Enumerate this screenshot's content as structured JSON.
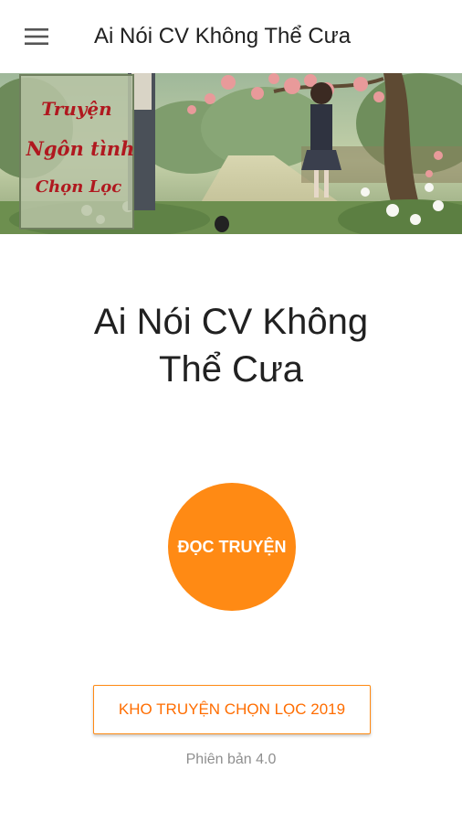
{
  "app_bar": {
    "title": "Ai Nói CV Không Thể Cưa",
    "menu_icon": "hamburger-menu-icon"
  },
  "banner": {
    "text_line1": "Truyện",
    "text_line2": "Ngôn tình",
    "text_line3": "Chọn Lọc"
  },
  "main": {
    "story_title_line1": "Ai Nói CV Không",
    "story_title_line2": "Thể Cưa",
    "read_button_label": "ĐỌC TRUYỆN",
    "library_button_label": "KHO TRUYỆN CHỌN LỌC 2019",
    "version_label": "Phiên bản 4.0"
  },
  "colors": {
    "accent": "#ff8a14",
    "accent_text": "#ff6d00",
    "title_text": "#212121",
    "version_text": "#8f8f8f"
  }
}
